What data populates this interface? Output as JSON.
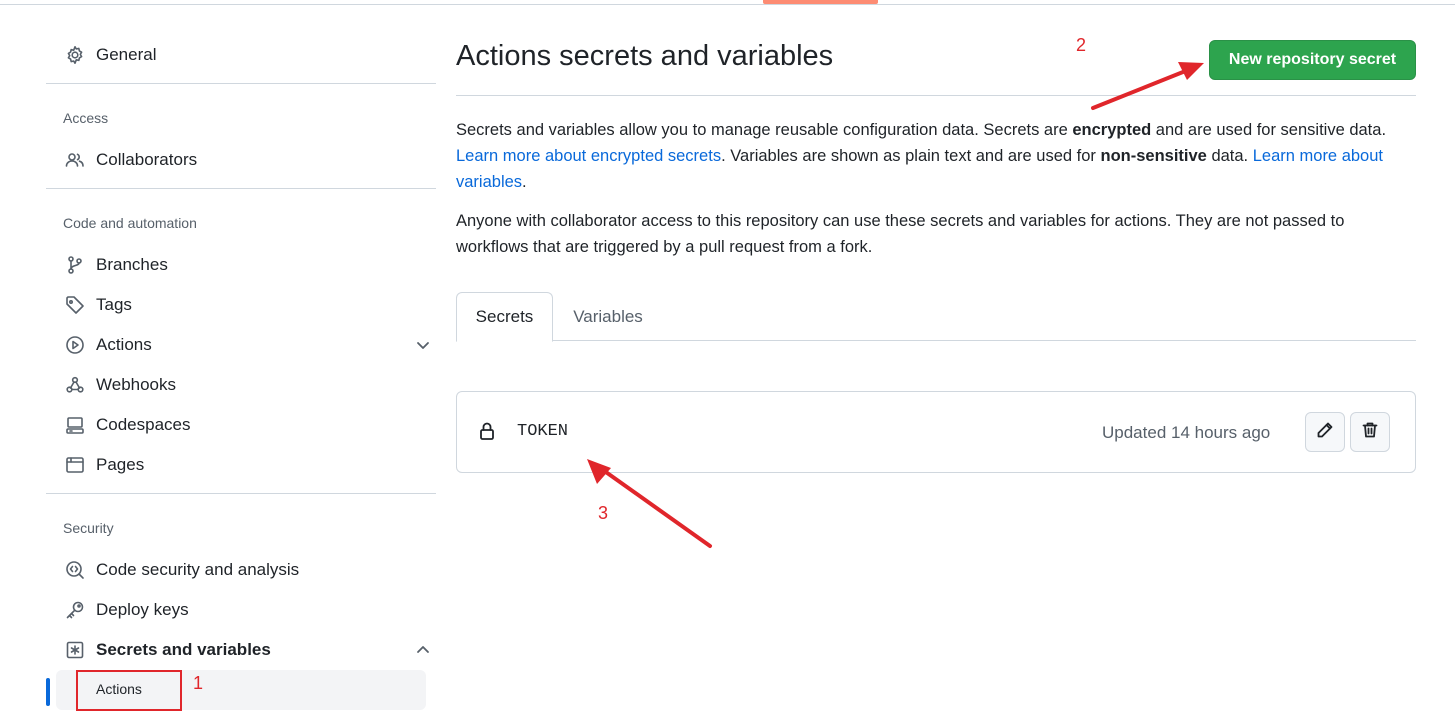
{
  "sidebar": {
    "general": "General",
    "access_title": "Access",
    "collaborators": "Collaborators",
    "code_title": "Code and automation",
    "branches": "Branches",
    "tags": "Tags",
    "actions": "Actions",
    "webhooks": "Webhooks",
    "codespaces": "Codespaces",
    "pages": "Pages",
    "security_title": "Security",
    "code_security": "Code security and analysis",
    "deploy_keys": "Deploy keys",
    "secrets_variables": "Secrets and variables",
    "sub_actions": "Actions"
  },
  "main": {
    "title": "Actions secrets and variables",
    "new_button": "New repository secret",
    "desc1_part1": "Secrets and variables allow you to manage reusable configuration data. Secrets are ",
    "desc1_bold1": "encrypted",
    "desc1_part2": " and are used for sensitive data. ",
    "desc1_link1": "Learn more about encrypted secrets",
    "desc1_part3": ". Variables are shown as plain text and are used for ",
    "desc1_bold2": "non-sensitive",
    "desc1_part4": " data. ",
    "desc1_link2": "Learn more about variables",
    "desc1_part5": ".",
    "desc2": "Anyone with collaborator access to this repository can use these secrets and variables for actions. They are not passed to workflows that are triggered by a pull request from a fork.",
    "tabs": [
      "Secrets",
      "Variables"
    ],
    "secret": {
      "name": "TOKEN",
      "updated": "Updated 14 hours ago"
    }
  },
  "annotations": {
    "n1": "1",
    "n2": "2",
    "n3": "3",
    "color": "#e0262b"
  },
  "colors": {
    "accent": "#0969da",
    "button_green": "#2da44e",
    "tab_underline": "#fd8c73"
  }
}
